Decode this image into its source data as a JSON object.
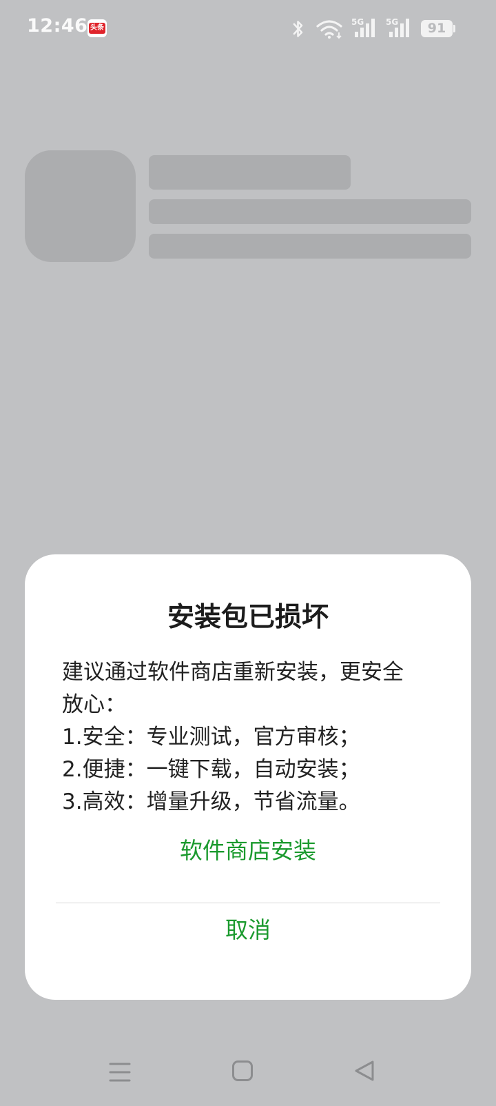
{
  "status_bar": {
    "time": "12:46",
    "app_badge_text": "头条",
    "icons": [
      "bluetooth-icon",
      "wifi-icon",
      "signal-5g-icon",
      "signal-5g-icon"
    ],
    "network_labels": [
      "5G",
      "5G"
    ],
    "battery_level": "91"
  },
  "dialog": {
    "title": "安装包已损坏",
    "body_lines": [
      "建议通过软件商店重新安装，更安全",
      "放心：",
      "1.安全：专业测试，官方审核；",
      "2.便捷：一键下载，自动安装；",
      "3.高效：增量升级，节省流量。"
    ],
    "primary_button": "软件商店安装",
    "cancel_button": "取消"
  },
  "navigation_bar": {
    "icons": [
      "menu-icon",
      "home-icon",
      "back-icon"
    ]
  },
  "colors": {
    "background": "#c0c1c3",
    "skeleton": "#acadaf",
    "accent_green": "#1b9a2e",
    "dialog_bg": "#ffffff"
  }
}
